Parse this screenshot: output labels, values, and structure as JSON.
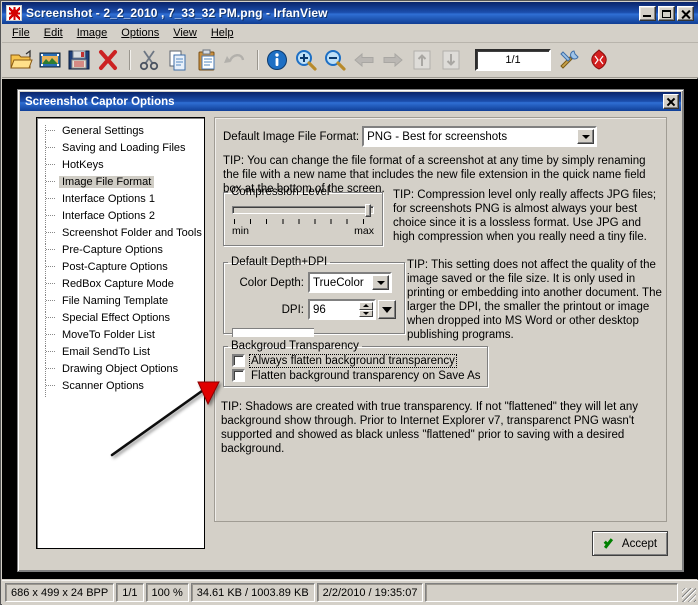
{
  "window": {
    "title": "Screenshot - 2_2_2010 , 7_33_32 PM.png - IrfanView",
    "icon": "irfanview-icon",
    "buttons": {
      "minimize": "–",
      "maximize": "□",
      "close": "✕"
    }
  },
  "menubar": {
    "items": [
      {
        "label": "File"
      },
      {
        "label": "Edit"
      },
      {
        "label": "Image"
      },
      {
        "label": "Options"
      },
      {
        "label": "View"
      },
      {
        "label": "Help"
      }
    ]
  },
  "toolbar": {
    "page_value": "1/1",
    "buttons": [
      {
        "name": "open-icon"
      },
      {
        "name": "thumbnails-icon"
      },
      {
        "name": "save-icon"
      },
      {
        "name": "delete-icon"
      },
      {
        "name": "cut-icon"
      },
      {
        "name": "copy-icon"
      },
      {
        "name": "paste-icon"
      },
      {
        "name": "undo-icon"
      },
      {
        "name": "info-icon"
      },
      {
        "name": "zoom-in-icon"
      },
      {
        "name": "zoom-out-icon"
      },
      {
        "name": "previous-icon"
      },
      {
        "name": "next-icon"
      },
      {
        "name": "first-icon"
      },
      {
        "name": "last-icon"
      },
      {
        "name": "settings-icon"
      },
      {
        "name": "effects-icon"
      }
    ]
  },
  "dialog": {
    "title": "Screenshot Captor Options",
    "close_label": "✕",
    "tree": {
      "items": [
        {
          "label": "General Settings",
          "selected": false
        },
        {
          "label": "Saving and Loading Files",
          "selected": false
        },
        {
          "label": "HotKeys",
          "selected": false
        },
        {
          "label": "Image File Format",
          "selected": true
        },
        {
          "label": "Interface Options 1",
          "selected": false
        },
        {
          "label": "Interface Options 2",
          "selected": false
        },
        {
          "label": "Screenshot Folder and Tools",
          "selected": false
        },
        {
          "label": "Pre-Capture Options",
          "selected": false
        },
        {
          "label": "Post-Capture Options",
          "selected": false
        },
        {
          "label": "RedBox Capture Mode",
          "selected": false
        },
        {
          "label": "File Naming Template",
          "selected": false
        },
        {
          "label": "Special Effect Options",
          "selected": false
        },
        {
          "label": "MoveTo Folder List",
          "selected": false
        },
        {
          "label": "Email SendTo List",
          "selected": false
        },
        {
          "label": "Drawing Object Options",
          "selected": false
        },
        {
          "label": "Scanner Options",
          "selected": false
        }
      ]
    },
    "pane": {
      "format_label": "Default Image File Format:",
      "format_value": "PNG - Best for screenshots",
      "format_tip": "TIP: You can change the file format of a screenshot at any time by simply renaming the file with a new name that includes the new file extension in the quick name field box at the bottom of the screen.",
      "compression": {
        "legend": "Compression Level",
        "min_label": "min",
        "max_label": "max",
        "value_position": "max",
        "tip": "TIP: Compression level only really affects JPG files; for screenshots PNG is almost always your best choice since it is a lossless format.  Use JPG and high compression when you really need a tiny file."
      },
      "depth": {
        "legend": "Default Depth+DPI",
        "color_depth_label": "Color Depth:",
        "color_depth_value": "TrueColor",
        "dpi_label": "DPI:",
        "dpi_value": "96",
        "tip": "TIP:  This setting does not affect the quality of the image saved or the file size.  It is only used in printing or embedding into another document.  The larger the DPI, the smaller the printout or image when dropped into MS Word or other desktop publishing programs."
      },
      "background": {
        "legend": "Backgroud Transparency",
        "checkbox1_label": "Always flatten background transparency",
        "checkbox1_checked": false,
        "checkbox2_label": "Flatten background transparency on Save As",
        "checkbox2_checked": false,
        "tip": "TIP: Shadows are created with true transparency.  If not \"flattened\" they will let any background show through.  Prior to Internet Explorer v7, transparenct PNG wasn't supported and showed as black unless \"flattened\" prior to saving with a desired background."
      }
    },
    "accept_label": "Accept"
  },
  "annotation": {
    "arrow_color": "#e00000",
    "line_color": "#111111"
  },
  "statusbar": {
    "dimensions": "686 x 499 x 24 BPP",
    "page": "1/1",
    "zoom": "100 %",
    "filesize": "34.61 KB / 1003.89 KB",
    "timestamp": "2/2/2010 / 19:35:07",
    "extra": ""
  },
  "colors": {
    "titlebar_start": "#0a246a",
    "titlebar_end": "#2f6fd4",
    "face": "#d4d0c8",
    "accept_check": "#008000"
  }
}
